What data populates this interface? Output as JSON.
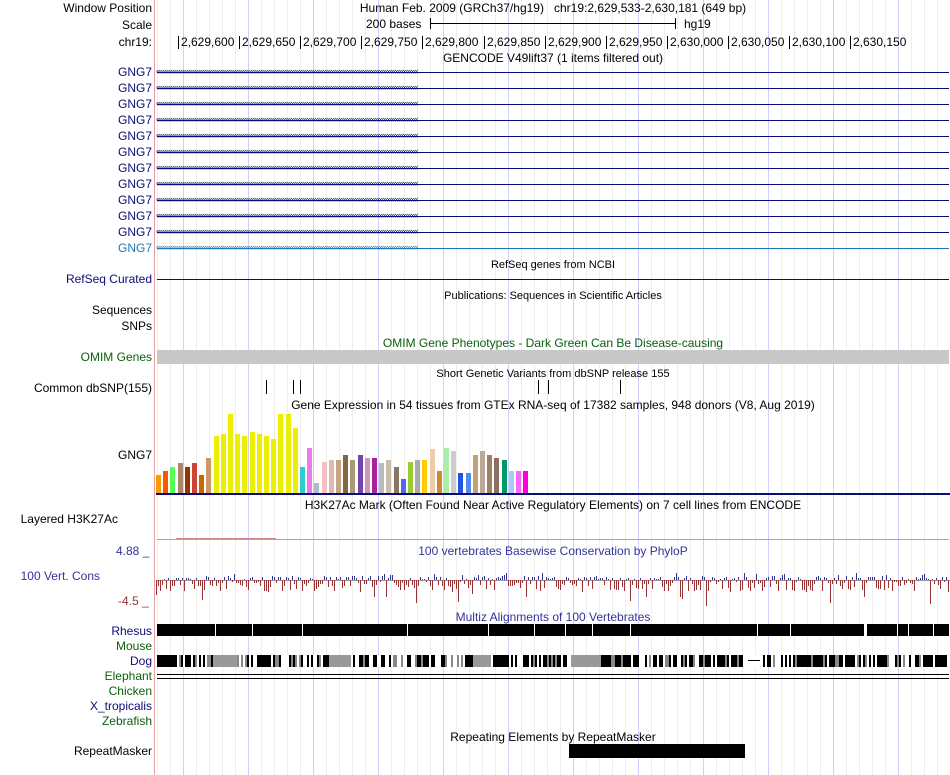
{
  "header": {
    "window_position_label": "Window Position",
    "scale_label": "Scale",
    "chrom_label": "chr19:",
    "assembly_title": "Human Feb. 2009 (GRCh37/hg19)",
    "position_title": "chr19:2,629,533-2,630,181 (649 bp)",
    "scale_text": "200 bases",
    "scale_db": "hg19",
    "ruler_ticks": [
      "2,629,600",
      "2,629,650",
      "2,629,700",
      "2,629,750",
      "2,629,800",
      "2,629,850",
      "2,629,900",
      "2,629,950",
      "2,630,000",
      "2,630,050",
      "2,630,100",
      "2,630,150"
    ]
  },
  "gencode": {
    "title": "GENCODE V49lift37 (1 items filtered out)",
    "items": [
      "GNG7",
      "GNG7",
      "GNG7",
      "GNG7",
      "GNG7",
      "GNG7",
      "GNG7",
      "GNG7",
      "GNG7",
      "GNG7",
      "GNG7",
      "GNG7"
    ],
    "color": "#0c0c78",
    "last_color": "#1f77b4"
  },
  "refseq": {
    "label": "RefSeq Curated",
    "title": "RefSeq genes from NCBI",
    "color": "#0c0c78"
  },
  "publications": {
    "label": "Sequences",
    "title": "Publications: Sequences in Scientific Articles"
  },
  "snps_label": "SNPs",
  "omim": {
    "label": "OMIM Genes",
    "title": "OMIM Gene Phenotypes - Dark Green Can Be Disease-causing",
    "color": "#0b5e0b"
  },
  "dbsnp": {
    "label": "Common dbSNP(155)",
    "title": "Short Genetic Variants from dbSNP release 155"
  },
  "gtex": {
    "title": "Gene Expression in 54 tissues from GTEx RNA-seq of 17382 samples, 948 donors (V8, Aug 2019)",
    "gene_label": "GNG7",
    "tissues": [
      {
        "value": 0.22,
        "color": "#ff9900"
      },
      {
        "value": 0.28,
        "color": "#ff5500"
      },
      {
        "value": 0.33,
        "color": "#55ff55"
      },
      {
        "value": 0.37,
        "color": "#aa8866"
      },
      {
        "value": 0.33,
        "color": "#993300"
      },
      {
        "value": 0.37,
        "color": "#cc4433"
      },
      {
        "value": 0.22,
        "color": "#cc6600"
      },
      {
        "value": 0.44,
        "color": "#cc9966"
      },
      {
        "value": 0.71,
        "color": "#eeee00"
      },
      {
        "value": 0.74,
        "color": "#eeee00"
      },
      {
        "value": 0.99,
        "color": "#eeee00"
      },
      {
        "value": 0.74,
        "color": "#eeee00"
      },
      {
        "value": 0.71,
        "color": "#eeee00"
      },
      {
        "value": 0.76,
        "color": "#eeee00"
      },
      {
        "value": 0.74,
        "color": "#eeee00"
      },
      {
        "value": 0.71,
        "color": "#eeee00"
      },
      {
        "value": 0.67,
        "color": "#eeee00"
      },
      {
        "value": 0.99,
        "color": "#eeee00"
      },
      {
        "value": 0.99,
        "color": "#eeee00"
      },
      {
        "value": 0.81,
        "color": "#eeee00"
      },
      {
        "value": 0.33,
        "color": "#33cccc"
      },
      {
        "value": 0.56,
        "color": "#ee77ee"
      },
      {
        "value": 0.12,
        "color": "#aabbcc"
      },
      {
        "value": 0.39,
        "color": "#f4c2c2"
      },
      {
        "value": 0.41,
        "color": "#ddbbaa"
      },
      {
        "value": 0.41,
        "color": "#c4a484"
      },
      {
        "value": 0.48,
        "color": "#886644"
      },
      {
        "value": 0.41,
        "color": "#aa9977"
      },
      {
        "value": 0.48,
        "color": "#7744aa"
      },
      {
        "value": 0.44,
        "color": "#cc99bb"
      },
      {
        "value": 0.44,
        "color": "#aa2299"
      },
      {
        "value": 0.37,
        "color": "#bbbbbb"
      },
      {
        "value": 0.41,
        "color": "#ccbbaa"
      },
      {
        "value": 0.33,
        "color": "#887766"
      },
      {
        "value": 0.18,
        "color": "#5566ee"
      },
      {
        "value": 0.39,
        "color": "#99cc33"
      },
      {
        "value": 0.41,
        "color": "#aaaaaa"
      },
      {
        "value": 0.41,
        "color": "#ffcc00"
      },
      {
        "value": 0.55,
        "color": "#eecca9"
      },
      {
        "value": 0.28,
        "color": "#cc8833"
      },
      {
        "value": 0.56,
        "color": "#aaeeaa"
      },
      {
        "value": 0.52,
        "color": "#cccccc"
      },
      {
        "value": 0.25,
        "color": "#2255dd"
      },
      {
        "value": 0.25,
        "color": "#5588ee"
      },
      {
        "value": 0.48,
        "color": "#c8a078"
      },
      {
        "value": 0.52,
        "color": "#bbaa99"
      },
      {
        "value": 0.48,
        "color": "#a08060"
      },
      {
        "value": 0.44,
        "color": "#8a7060"
      },
      {
        "value": 0.41,
        "color": "#009966"
      },
      {
        "value": 0.28,
        "color": "#aaccee"
      },
      {
        "value": 0.28,
        "color": "#ff66ff"
      },
      {
        "value": 0.28,
        "color": "#ff00dd"
      }
    ]
  },
  "h3k27ac": {
    "label": "Layered H3K27Ac",
    "title": "H3K27Ac Mark (Often Found Near Active Regulatory Elements) on 7 cell lines from ENCODE"
  },
  "conservation": {
    "label": "100 Vert. Cons",
    "title": "100 vertebrates Basewise Conservation by PhyloP",
    "max_label": "4.88 _",
    "min_label": "-4.5 _",
    "color": "#333399"
  },
  "multiz": {
    "title": "Multiz Alignments of 100 Vertebrates",
    "species": [
      {
        "name": "Rhesus",
        "color": "#0c0c78"
      },
      {
        "name": "Mouse",
        "color": "#0b5e0b"
      },
      {
        "name": "Dog",
        "color": "#0c0c78"
      },
      {
        "name": "Elephant",
        "color": "#0b5e0b"
      },
      {
        "name": "Chicken",
        "color": "#0b5e0b"
      },
      {
        "name": "X_tropicalis",
        "color": "#0c0c78"
      },
      {
        "name": "Zebrafish",
        "color": "#0b5e0b"
      }
    ]
  },
  "repeatmasker": {
    "label": "RepeatMasker",
    "title": "Repeating Elements by RepeatMasker"
  }
}
